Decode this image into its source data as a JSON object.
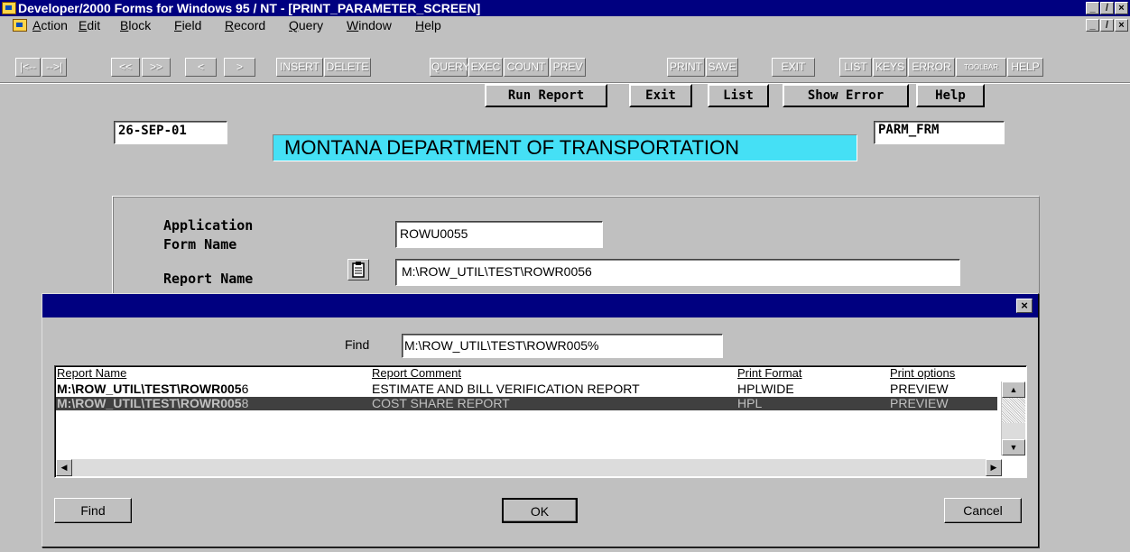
{
  "window": {
    "title": "Developer/2000 Forms for Windows 95 / NT  - [PRINT_PARAMETER_SCREEN]",
    "controls": [
      "_",
      "̸",
      "×"
    ]
  },
  "menu": {
    "items": [
      {
        "label": "Action",
        "ul": "A",
        "rest": "ction"
      },
      {
        "label": "Edit",
        "ul": "E",
        "rest": "dit"
      },
      {
        "label": "Block",
        "ul": "B",
        "rest": "lock"
      },
      {
        "label": "Field",
        "ul": "F",
        "rest": "ield"
      },
      {
        "label": "Record",
        "ul": "R",
        "rest": "ecord"
      },
      {
        "label": "Query",
        "ul": "Q",
        "rest": "uery"
      },
      {
        "label": "Window",
        "ul": "W",
        "rest": "indow"
      },
      {
        "label": "Help",
        "ul": "H",
        "rest": "elp"
      }
    ]
  },
  "toolbar": {
    "buttons": [
      "|<--",
      "-->|",
      "<<",
      ">>",
      "<",
      ">",
      "INSERT",
      "DELETE",
      "QUERY",
      "EXEC",
      "COUNT",
      "PREV",
      "PRINT",
      "SAVE",
      "EXIT",
      "LIST",
      "KEYS",
      "ERROR",
      "TOOLBAR",
      "HELP"
    ]
  },
  "actions": {
    "run_report": "Run Report",
    "exit": "Exit",
    "list": "List",
    "show_error": "Show Error",
    "help": "Help"
  },
  "header": {
    "date": "26-SEP-01",
    "form_code": "PARM_FRM",
    "banner": "MONTANA DEPARTMENT OF TRANSPORTATION"
  },
  "form": {
    "app_label_line1": "Application",
    "app_label_line2": "Form Name",
    "app_value": "ROWU0055",
    "report_label": "Report Name",
    "report_value": "M:\\ROW_UTIL\\TEST\\ROWR0056"
  },
  "dialog": {
    "close": "×",
    "find_label": "Find",
    "find_value": "M:\\ROW_UTIL\\TEST\\ROWR005%",
    "columns": [
      "Report Name",
      "Report Comment",
      "Print Format",
      "Print options"
    ],
    "rows": [
      {
        "name": "M:\\ROW_UTIL\\TEST\\ROWR005",
        "name_tail": "6",
        "comment": "ESTIMATE AND BILL VERIFICATION REPORT",
        "format": "HPLWIDE",
        "options": "PREVIEW"
      },
      {
        "name": "M:\\ROW_UTIL\\TEST\\ROWR005",
        "name_tail": "8",
        "comment": "COST SHARE REPORT",
        "format": "HPL",
        "options": "PREVIEW"
      }
    ],
    "buttons": {
      "find": "Find",
      "ok": "OK",
      "cancel": "Cancel"
    }
  }
}
